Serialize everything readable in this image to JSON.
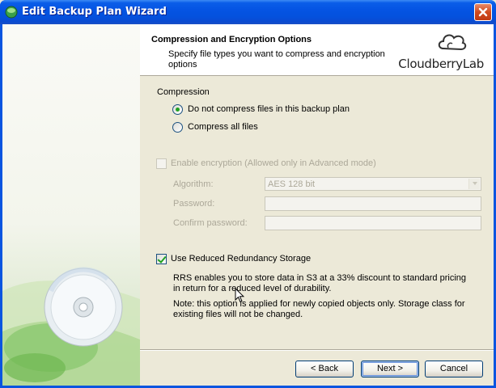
{
  "window": {
    "title": "Edit Backup Plan Wizard"
  },
  "header": {
    "title": "Compression and Encryption Options",
    "subtitle": "Specify file types you want to compress and encryption options",
    "logo_text": "CloudberryLab"
  },
  "compression": {
    "group_label": "Compression",
    "options": [
      {
        "label": "Do not compress files in this backup plan",
        "selected": true
      },
      {
        "label": "Compress all files",
        "selected": false
      }
    ]
  },
  "encryption": {
    "enable_label": "Enable encryption (Allowed only in Advanced mode)",
    "enabled": false,
    "algorithm_label": "Algorithm:",
    "algorithm_value": "AES 128 bit",
    "password_label": "Password:",
    "password_value": "",
    "confirm_label": "Confirm password:",
    "confirm_value": ""
  },
  "rrs": {
    "label": "Use Reduced Redundancy Storage",
    "checked": true,
    "description": "RRS enables you to store data in S3 at a 33% discount to standard pricing in return for a reduced level of durability.",
    "note": "Note: this option is applied for newly copied objects only. Storage class for existing files will not be changed."
  },
  "footer": {
    "back_label": "< Back",
    "next_label": "Next >",
    "cancel_label": "Cancel"
  },
  "colors": {
    "titlebar": "#0554e3",
    "accent_green": "#21a121"
  }
}
